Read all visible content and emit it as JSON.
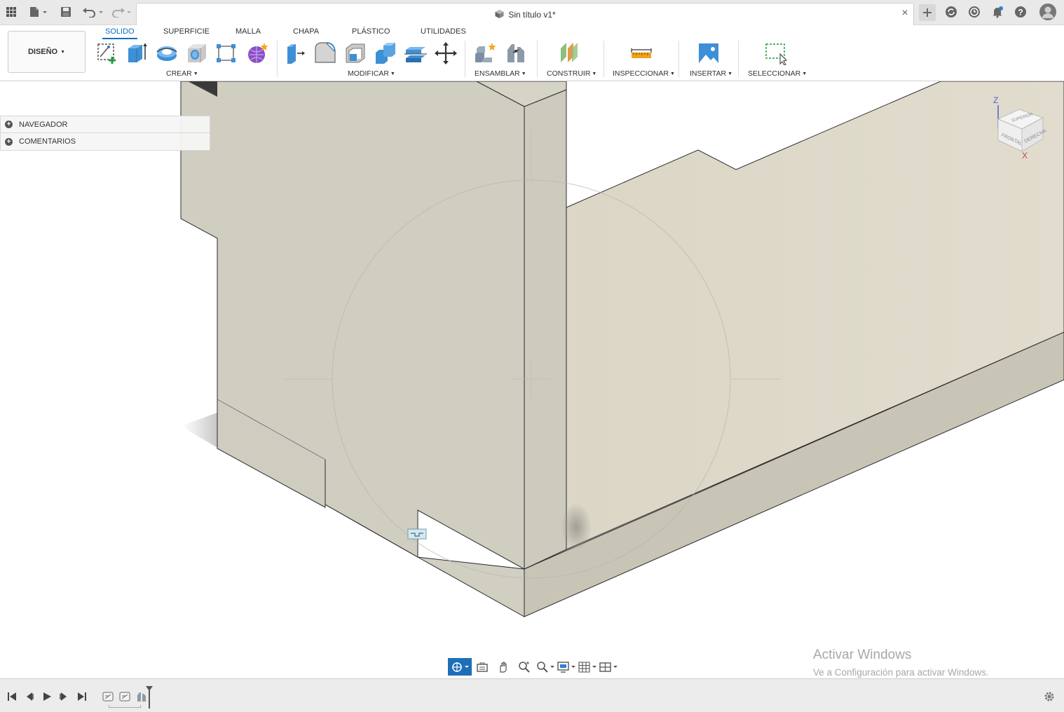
{
  "titlebar": {
    "document_title": "Sin título v1*",
    "icons": [
      "apps-grid-icon",
      "file-menu-icon",
      "save-icon",
      "undo-icon",
      "redo-icon",
      "close-icon",
      "new-tab-icon",
      "extensions-icon",
      "job-status-icon",
      "notifications-icon",
      "help-icon",
      "user-avatar-icon"
    ]
  },
  "toolbar": {
    "workspace": "DISEÑO",
    "tabs": [
      "SOLIDO",
      "SUPERFICIE",
      "MALLA",
      "CHAPA",
      "PLÁSTICO",
      "UTILIDADES"
    ],
    "active_tab": "SOLIDO",
    "groups": {
      "crear": "CREAR",
      "modificar": "MODIFICAR",
      "ensamblar": "ENSAMBLAR",
      "construir": "CONSTRUIR",
      "inspeccionar": "INSPECCIONAR",
      "insertar": "INSERTAR",
      "seleccionar": "SELECCIONAR"
    }
  },
  "browser": {
    "items": [
      "NAVEGADOR",
      "COMENTARIOS"
    ]
  },
  "viewcube": {
    "axis_z": "Z",
    "axis_x": "X",
    "face_top": "SUPERIOR",
    "face_front": "FRONTAL",
    "face_right": "DERECHA"
  },
  "watermark": {
    "title": "Activar Windows",
    "subtitle": "Ve a Configuración para activar Windows."
  },
  "colors": {
    "accent": "#0f6ebf",
    "body_face_light": "#dcd8c8",
    "body_face_mid": "#d2cfc3",
    "body_face_dark": "#c9c5b7",
    "watermark": "#a7a7a7"
  }
}
